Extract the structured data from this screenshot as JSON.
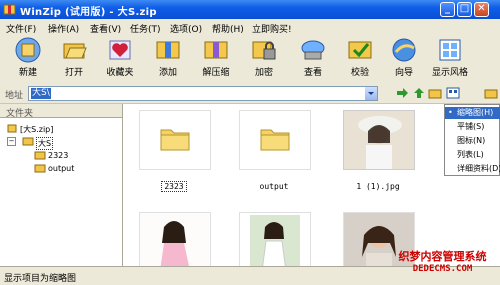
{
  "window": {
    "title": "WinZip (试用版) - 大S.zip"
  },
  "menu": [
    "文件(F)",
    "操作(A)",
    "查看(V)",
    "任务(T)",
    "选项(O)",
    "帮助(H)",
    "立即购买!"
  ],
  "toolbar": [
    {
      "label": "新建",
      "icon": "new-archive-icon"
    },
    {
      "label": "打开",
      "icon": "open-archive-icon"
    },
    {
      "label": "收藏夹",
      "icon": "favorites-icon"
    },
    {
      "label": "添加",
      "icon": "add-icon"
    },
    {
      "label": "解压缩",
      "icon": "extract-icon"
    },
    {
      "label": "加密",
      "icon": "encrypt-icon"
    },
    {
      "label": "查看",
      "icon": "view-icon"
    },
    {
      "label": "校验",
      "icon": "check-icon"
    },
    {
      "label": "向导",
      "icon": "wizard-icon"
    },
    {
      "label": "显示风格",
      "icon": "view-style-icon"
    }
  ],
  "address": {
    "label": "地址",
    "value": "大S\\"
  },
  "folders": {
    "title": "文件夹",
    "tree": [
      "[大S.zip]",
      "大S",
      "2323",
      "output"
    ]
  },
  "thumbnails": [
    "2323",
    "output",
    "1 (1).jpg"
  ],
  "view_menu": {
    "items": [
      "缩略图(H)",
      "平铺(S)",
      "图标(N)",
      "列表(L)",
      "详细资料(D)"
    ],
    "selected_index": 0
  },
  "status": {
    "text": "显示项目为缩略图"
  },
  "watermark": {
    "line1": "织梦内容管理系统",
    "line2": "DEDECMS.COM"
  },
  "colors": {
    "titlebar": "#0a4fd4",
    "selection": "#316ac5",
    "watermark": "#cc0000"
  }
}
